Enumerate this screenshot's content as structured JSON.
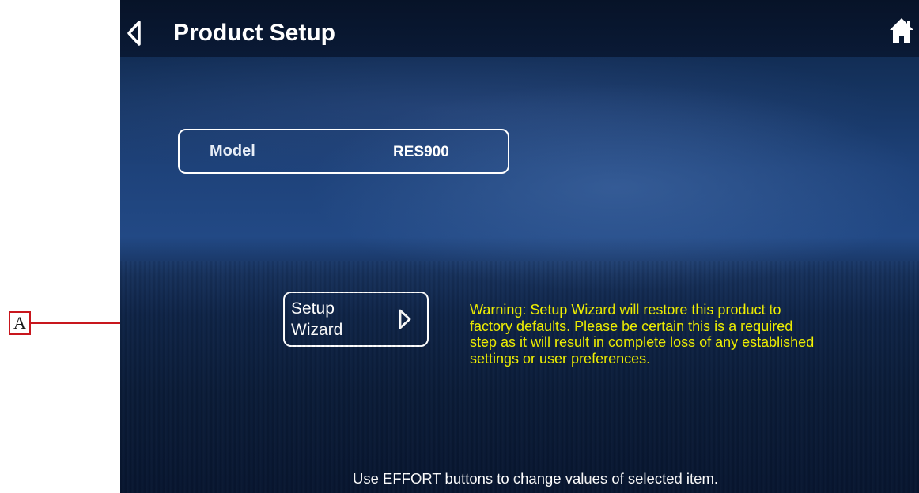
{
  "callout": {
    "label": "A"
  },
  "header": {
    "title": "Product Setup",
    "back_icon": "chevron-left-icon",
    "home_icon": "home-icon"
  },
  "model": {
    "label": "Model",
    "value": "RES900"
  },
  "setup_wizard": {
    "label": "Setup Wizard",
    "icon": "chevron-right-icon"
  },
  "warning": {
    "text": "Warning: Setup Wizard will restore this product to factory defaults. Please be certain this is a required step as it will result in complete loss of any established settings or user preferences."
  },
  "footer": {
    "hint": "Use EFFORT buttons to change values of selected item."
  },
  "colors": {
    "callout": "#c8161d",
    "warning_text": "#f2f200",
    "screen_background": "#1e427a",
    "header_background": "#0a1a36"
  }
}
